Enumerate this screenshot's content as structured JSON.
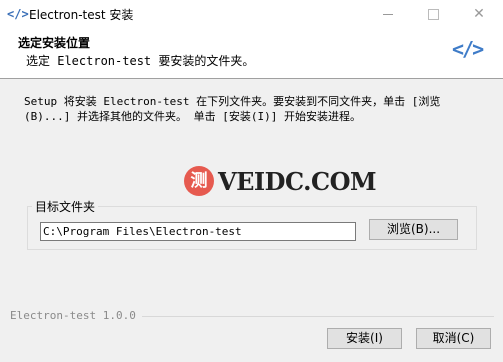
{
  "window": {
    "title": "Electron-test 安装",
    "app_icon": "</>",
    "minimize_icon": "minimize-icon",
    "maximize_icon": "maximize-icon",
    "close_glyph": "✕"
  },
  "header": {
    "title": "选定安装位置",
    "subtitle": "选定 Electron-test 要安装的文件夹。",
    "logo": "</>",
    "logo_color": "#3f7cc8"
  },
  "intro_text": "Setup 将安装 Electron-test 在下列文件夹。要安装到不同文件夹，单击 [浏览(B)...] 并选择其他的文件夹。 单击 [安装(I)] 开始安装进程。",
  "watermark": {
    "badge": "测",
    "text": "VEIDC.COM",
    "badge_color": "#e65a4f"
  },
  "destination": {
    "group_label": "目标文件夹",
    "path_value": "C:\\Program Files\\Electron-test",
    "browse_label": "浏览(B)..."
  },
  "footer": {
    "branding": "Electron-test 1.0.0",
    "install_label": "安装(I)",
    "cancel_label": "取消(C)"
  }
}
